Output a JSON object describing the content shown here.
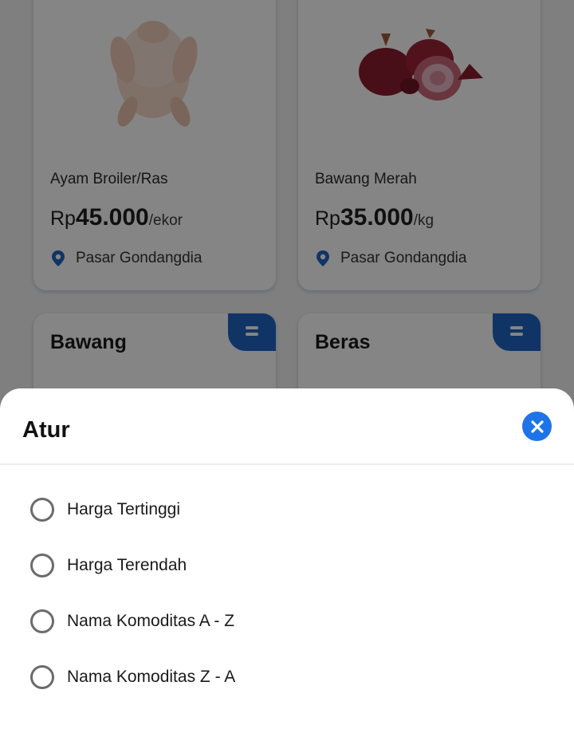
{
  "products": [
    {
      "name": "Ayam Broiler/Ras",
      "price_currency": "Rp",
      "price_amount": "45.000",
      "price_unit": "/ekor",
      "market": "Pasar Gondangdia",
      "image_icon": "chicken-image"
    },
    {
      "name": "Bawang Merah",
      "price_currency": "Rp",
      "price_amount": "35.000",
      "price_unit": "/kg",
      "market": "Pasar Gondangdia",
      "image_icon": "shallot-image"
    }
  ],
  "categories": [
    {
      "title": "Bawang",
      "icon": "menu-icon"
    },
    {
      "title": "Beras",
      "icon": "menu-icon"
    }
  ],
  "sheet": {
    "title": "Atur",
    "close_icon": "close-icon",
    "options": [
      {
        "label": "Harga Tertinggi",
        "selected": false
      },
      {
        "label": "Harga Terendah",
        "selected": false
      },
      {
        "label": "Nama Komoditas A - Z",
        "selected": false
      },
      {
        "label": "Nama Komoditas Z - A",
        "selected": false
      }
    ]
  },
  "colors": {
    "accent": "#1f73e8",
    "badge": "#1f64c4",
    "overlay": "rgba(0,0,0,0.48)"
  }
}
